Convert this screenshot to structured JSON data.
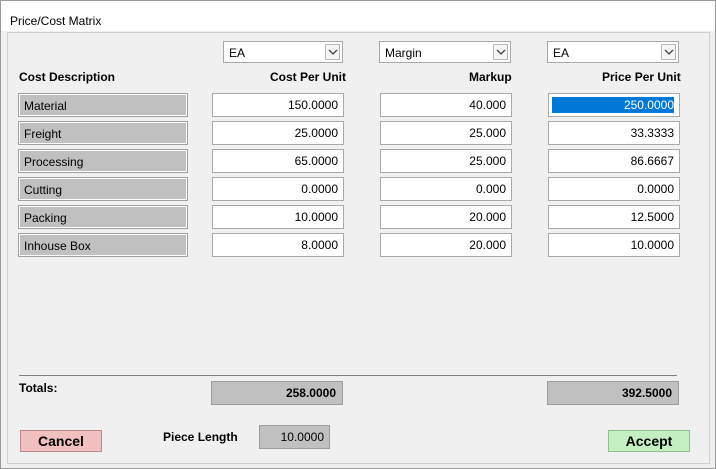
{
  "window": {
    "title": "Price/Cost Matrix"
  },
  "selects": {
    "cost_unit": "EA",
    "markup_mode": "Margin",
    "price_unit": "EA"
  },
  "headers": {
    "description": "Cost Description",
    "cost": "Cost Per Unit",
    "markup": "Markup",
    "price": "Price Per Unit"
  },
  "rows": [
    {
      "label": "Material",
      "cost": "150.0000",
      "markup": "40.000",
      "price": "250.0000"
    },
    {
      "label": "Freight",
      "cost": "25.0000",
      "markup": "25.000",
      "price": "33.3333"
    },
    {
      "label": "Processing",
      "cost": "65.0000",
      "markup": "25.000",
      "price": "86.6667"
    },
    {
      "label": "Cutting",
      "cost": "0.0000",
      "markup": "0.000",
      "price": "0.0000"
    },
    {
      "label": "Packing",
      "cost": "10.0000",
      "markup": "20.000",
      "price": "12.5000"
    },
    {
      "label": "Inhouse Box",
      "cost": "8.0000",
      "markup": "20.000",
      "price": "10.0000"
    }
  ],
  "totals": {
    "label": "Totals:",
    "cost": "258.0000",
    "price": "392.5000"
  },
  "piece_length": {
    "label": "Piece Length",
    "value": "10.0000"
  },
  "buttons": {
    "cancel": "Cancel",
    "accept": "Accept"
  },
  "colors": {
    "selection": "#0078d7",
    "cancel_bg": "#f2c0c0",
    "accept_bg": "#c3efc3",
    "readonly_bg": "#c0c0c0"
  },
  "icons": {
    "dropdown": "chevron-down-icon"
  }
}
